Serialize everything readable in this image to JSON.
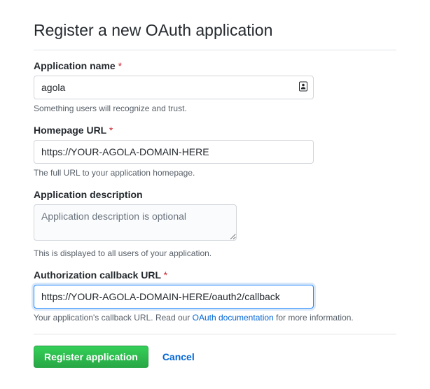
{
  "page_title": "Register a new OAuth application",
  "required_marker": "*",
  "fields": {
    "app_name": {
      "label": "Application name",
      "required": true,
      "value": "agola",
      "hint": "Something users will recognize and trust."
    },
    "homepage_url": {
      "label": "Homepage URL",
      "required": true,
      "value": "https://YOUR-AGOLA-DOMAIN-HERE",
      "hint": "The full URL to your application homepage."
    },
    "description": {
      "label": "Application description",
      "required": false,
      "placeholder": "Application description is optional",
      "hint": "This is displayed to all users of your application."
    },
    "callback_url": {
      "label": "Authorization callback URL",
      "required": true,
      "value": "https://YOUR-AGOLA-DOMAIN-HERE/oauth2/callback",
      "hint_prefix": "Your application's callback URL. Read our ",
      "hint_link_text": "OAuth documentation",
      "hint_suffix": " for more information."
    }
  },
  "actions": {
    "submit_label": "Register application",
    "cancel_label": "Cancel"
  }
}
